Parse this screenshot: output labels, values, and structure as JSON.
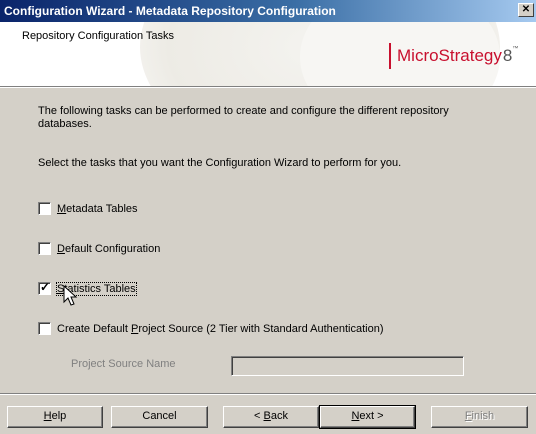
{
  "window": {
    "title": "Configuration Wizard - Metadata Repository Configuration",
    "close_glyph": "✕"
  },
  "header": {
    "subtitle": "Repository Configuration Tasks",
    "logo_text": "MicroStrategy",
    "logo_version": "8",
    "logo_tm": "™",
    "brand_color": "#c8102e"
  },
  "body": {
    "intro": "The following tasks can be performed to create and configure the different repository databases.",
    "instruction": "Select the tasks that you want the Configuration Wizard to perform for you."
  },
  "tasks": [
    {
      "label_pre": "",
      "label_key": "M",
      "label_post": "etadata Tables",
      "checked": false
    },
    {
      "label_pre": "",
      "label_key": "D",
      "label_post": "efault Configuration",
      "checked": false
    },
    {
      "label_pre": "",
      "label_key": "S",
      "label_post": "tatistics Tables",
      "checked": true,
      "focused": true
    },
    {
      "label_pre": "Create Default ",
      "label_key": "P",
      "label_post": "roject Source (2 Tier with Standard Authentication)",
      "checked": false
    }
  ],
  "check_glyph": "✓",
  "project_source": {
    "label": "Project Source Name",
    "value": "",
    "enabled": false
  },
  "buttons": {
    "help_key": "H",
    "help_rest": "elp",
    "cancel": "Cancel",
    "back_pre": "< ",
    "back_key": "B",
    "back_rest": "ack",
    "next_key": "N",
    "next_rest": "ext >",
    "finish_key": "F",
    "finish_rest": "inish"
  }
}
